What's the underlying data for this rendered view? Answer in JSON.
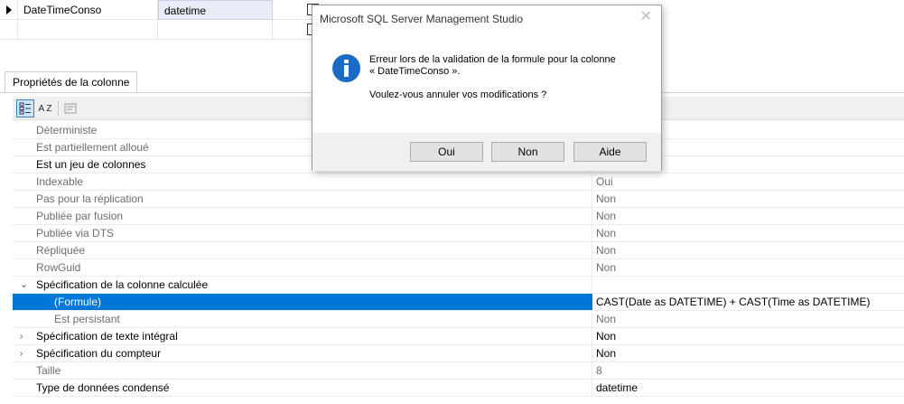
{
  "grid": {
    "rows": [
      {
        "name": "DateTimeConso",
        "type": "datetime"
      },
      {
        "name": "",
        "type": ""
      }
    ]
  },
  "panel": {
    "tab_label": "Propriétés de la colonne",
    "toolbar": {
      "categorized_icon": "categorized-icon",
      "alpha_sort_icon": "alpha-sort-icon",
      "alpha_sort_text": "A Z",
      "property_pages_icon": "property-pages-icon"
    },
    "properties": [
      {
        "name": "Déterministe",
        "value": ""
      },
      {
        "name": "Est partiellement alloué",
        "value": ""
      },
      {
        "name": "Est un jeu de colonnes",
        "value": ""
      },
      {
        "name": "Indexable",
        "value": "Oui"
      },
      {
        "name": "Pas pour la réplication",
        "value": "Non"
      },
      {
        "name": "Publiée par fusion",
        "value": "Non"
      },
      {
        "name": "Publiée via DTS",
        "value": "Non"
      },
      {
        "name": "Répliquée",
        "value": "Non"
      },
      {
        "name": "RowGuid",
        "value": "Non"
      },
      {
        "name": "Spécification de la colonne calculée",
        "value": ""
      },
      {
        "name": "(Formule)",
        "value": "CAST(Date as DATETIME) + CAST(Time as DATETIME)"
      },
      {
        "name": "Est persistant",
        "value": "Non"
      },
      {
        "name": "Spécification de texte intégral",
        "value": "Non"
      },
      {
        "name": "Spécification du compteur",
        "value": "Non"
      },
      {
        "name": "Taille",
        "value": "8"
      },
      {
        "name": "Type de données condensé",
        "value": "datetime"
      }
    ]
  },
  "dialog": {
    "title": "Microsoft SQL Server Management Studio",
    "close_glyph": "✕",
    "icon": "info-icon",
    "message_line1": "Erreur lors de la validation de la formule pour la colonne",
    "message_line2": "« DateTimeConso ».",
    "question": "Voulez-vous annuler vos modifications ?",
    "buttons": {
      "yes": "Oui",
      "no": "Non",
      "help": "Aide"
    }
  },
  "colors": {
    "selection": "#0078d7",
    "info_icon": "#1b6bc5",
    "dialog_footer": "#f0f0f0"
  }
}
